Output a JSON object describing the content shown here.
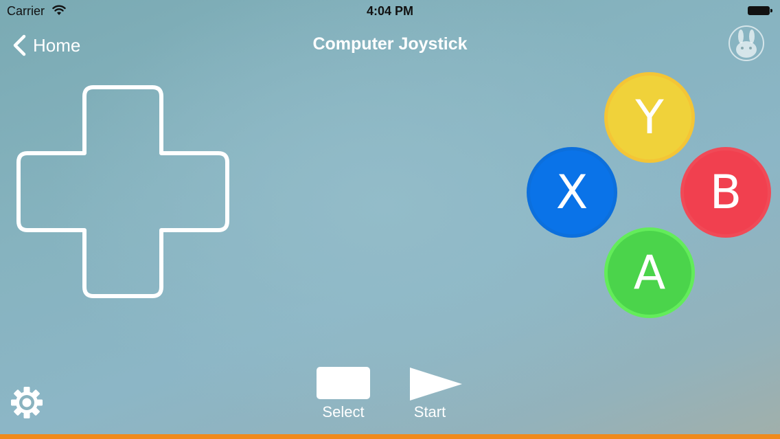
{
  "status_bar": {
    "carrier": "Carrier",
    "time": "4:04 PM",
    "wifi_icon": "wifi-icon",
    "battery_icon": "battery-icon"
  },
  "nav": {
    "back_label": "Home",
    "back_icon": "chevron-left-icon",
    "title": "Computer Joystick",
    "right_icon": "bunny-mascot-icon"
  },
  "dpad": {
    "icon": "dpad-outline"
  },
  "face_buttons": {
    "y": {
      "label": "Y",
      "color": "#f0d23a"
    },
    "x": {
      "label": "X",
      "color": "#0a73e8"
    },
    "b": {
      "label": "B",
      "color": "#f1404f"
    },
    "a": {
      "label": "A",
      "color": "#4bd44b"
    }
  },
  "controls": {
    "select_label": "Select",
    "start_label": "Start",
    "settings_icon": "gear-icon"
  },
  "colors": {
    "accent_bar": "#f08a1c",
    "background": "#8cb6c6"
  }
}
